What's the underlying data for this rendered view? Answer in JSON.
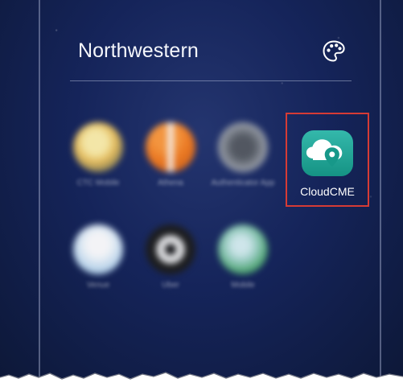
{
  "folder": {
    "title": "Northwestern",
    "palette_icon": "palette-icon"
  },
  "apps": [
    {
      "name": "blurred-app-1",
      "label": "CTC Mobile",
      "icon": "blurred-sun-app-icon",
      "color": "#f4d06f"
    },
    {
      "name": "blurred-app-2",
      "label": "Athena",
      "icon": "blurred-basketball-app-icon",
      "color": "#f57c1f"
    },
    {
      "name": "blurred-app-3",
      "label": "Authenticator App",
      "icon": "blurred-gray-app-icon",
      "color": "#8a8f97"
    },
    {
      "name": "cloudcme-app",
      "label": "CloudCME",
      "icon": "cloudcme-icon",
      "color": "#1fa69a"
    },
    {
      "name": "blurred-app-4",
      "label": "Venue",
      "icon": "blurred-pin-app-icon",
      "color": "#dfeefa"
    },
    {
      "name": "blurred-app-5",
      "label": "Uber",
      "icon": "blurred-uber-app-icon",
      "color": "#1d1d1d"
    },
    {
      "name": "blurred-app-6",
      "label": "Mobile",
      "icon": "blurred-phone-app-icon",
      "color": "#4ea86e"
    }
  ],
  "highlight_color": "#d63b35"
}
